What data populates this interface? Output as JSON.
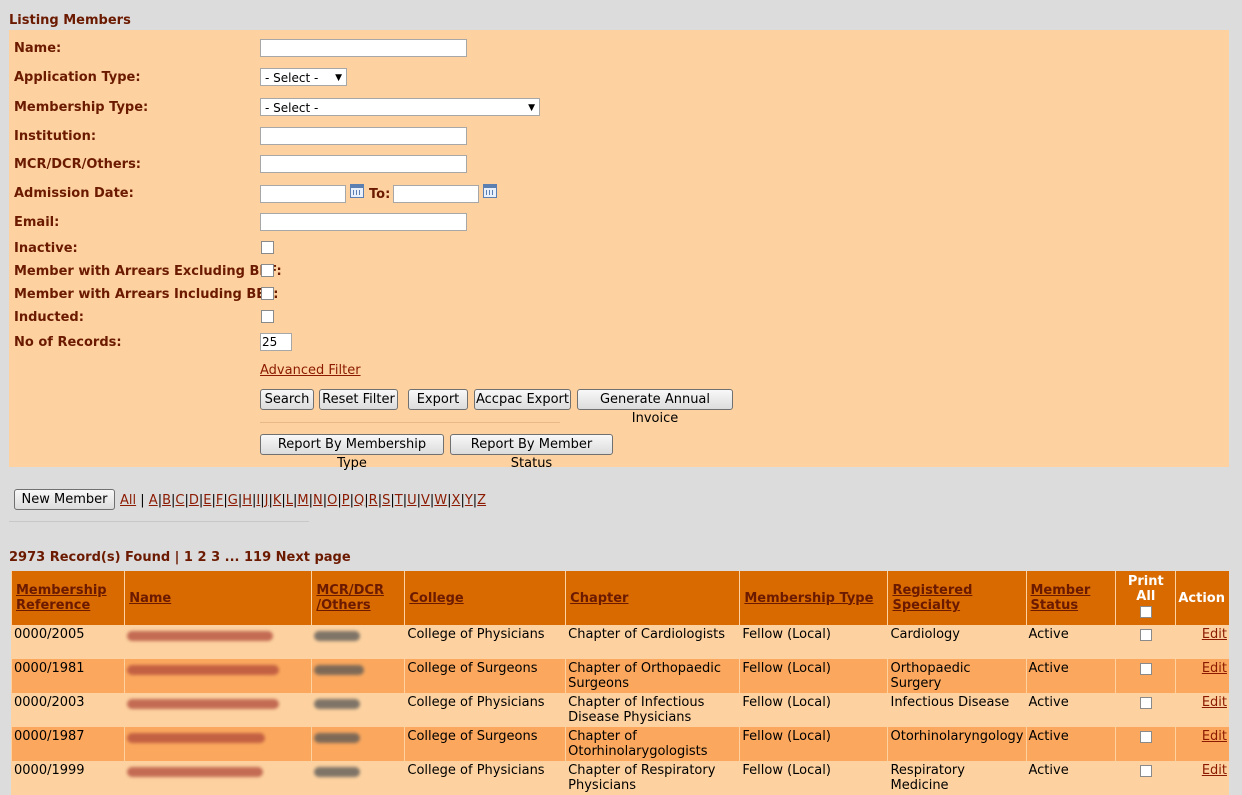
{
  "page": {
    "title": "Listing Members"
  },
  "filters": {
    "name_label": "Name:",
    "application_type_label": "Application Type:",
    "application_type_value": "- Select -",
    "membership_type_label": "Membership Type:",
    "membership_type_value": "- Select -",
    "institution_label": "Institution:",
    "mcr_label": "MCR/DCR/Others:",
    "admission_date_label": "Admission Date:",
    "to_label": "To:",
    "email_label": "Email:",
    "inactive_label": "Inactive:",
    "arrears_excl_label": "Member with Arrears Excluding BEF:",
    "arrears_incl_label": "Member with Arrears Including BEF:",
    "inducted_label": "Inducted:",
    "no_records_label": "No of Records:",
    "no_records_value": "25",
    "advanced_filter": "Advanced Filter"
  },
  "buttons": {
    "search": "Search",
    "reset": "Reset Filter",
    "export": "Export",
    "accpac": "Accpac Export",
    "invoice": "Generate Annual Invoice",
    "report_type": "Report By Membership Type",
    "report_status": "Report By Member Status",
    "new_member": "New Member"
  },
  "alphabet": {
    "all": "All",
    "letters": [
      "A",
      "B",
      "C",
      "D",
      "E",
      "F",
      "G",
      "H",
      "I",
      "J",
      "K",
      "L",
      "M",
      "N",
      "O",
      "P",
      "Q",
      "R",
      "S",
      "T",
      "U",
      "V",
      "W",
      "X",
      "Y",
      "Z"
    ]
  },
  "pagination": {
    "summary": "2973 Record(s) Found | 1 2 3 ... 119 Next page"
  },
  "table": {
    "headers": {
      "reference": [
        "Membership",
        "Reference"
      ],
      "name": "Name",
      "mcr": [
        "MCR/DCR",
        "/Others"
      ],
      "college": "College",
      "chapter": "Chapter",
      "membership_type": "Membership Type",
      "specialty": [
        "Registered",
        "Specialty"
      ],
      "status": [
        "Member",
        "Status"
      ],
      "print_all": "Print All",
      "action": "Action"
    },
    "rows": [
      {
        "reference": "0000/2005",
        "college": "College of Physicians",
        "chapter": "Chapter of Cardiologists",
        "membership_type": "Fellow (Local)",
        "specialty": "Cardiology",
        "status": "Active",
        "action": "Edit"
      },
      {
        "reference": "0000/1981",
        "college": "College of Surgeons",
        "chapter": "Chapter of Orthopaedic Surgeons",
        "membership_type": "Fellow (Local)",
        "specialty": "Orthopaedic Surgery",
        "status": "Active",
        "action": "Edit"
      },
      {
        "reference": "0000/2003",
        "college": "College of Physicians",
        "chapter": "Chapter of Infectious Disease Physicians",
        "membership_type": "Fellow (Local)",
        "specialty": "Infectious Disease",
        "status": "Active",
        "action": "Edit"
      },
      {
        "reference": "0000/1987",
        "college": "College of Surgeons",
        "chapter": "Chapter of Otorhinolarygologists",
        "membership_type": "Fellow (Local)",
        "specialty": "Otorhinolaryngology",
        "status": "Active",
        "action": "Edit"
      },
      {
        "reference": "0000/1999",
        "college": "College of Physicians",
        "chapter": "Chapter of Respiratory Physicians",
        "membership_type": "Fellow (Local)",
        "specialty": "Respiratory Medicine",
        "status": "Active",
        "action": "Edit"
      }
    ]
  },
  "colors": {
    "page_bg": "#dcdcdc",
    "filter_bg": "#fdd2a0",
    "header_bg": "#d86a00",
    "row_alt": "#fba85e",
    "label_text": "#6b1a00",
    "link": "#8b1a00"
  }
}
